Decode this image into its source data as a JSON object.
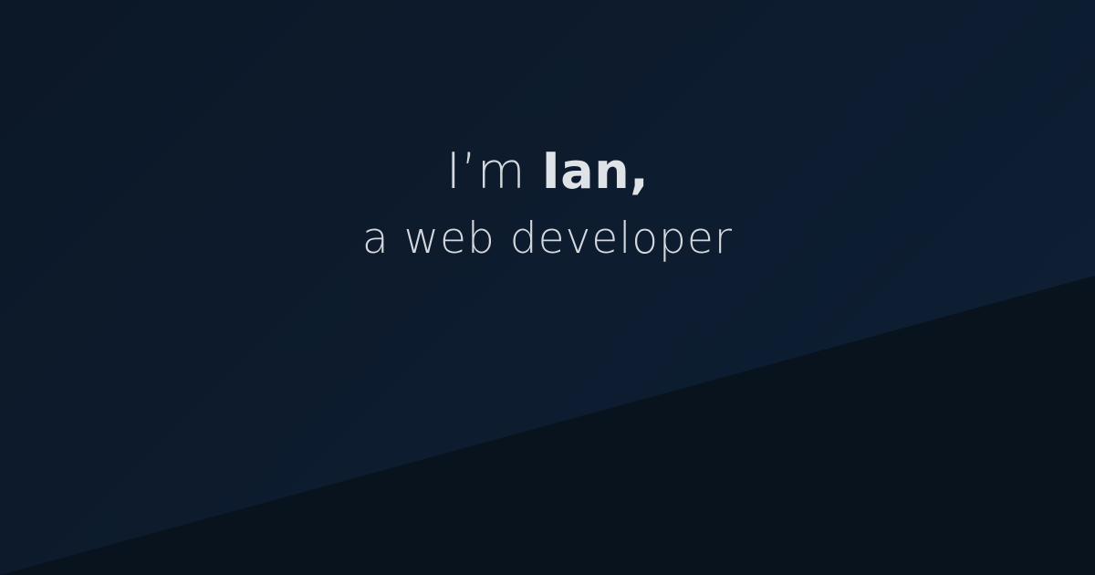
{
  "headline": {
    "prefix": "I’m ",
    "name": "Ian,",
    "tagline": "a web developer"
  },
  "colors": {
    "background": "#0d1a2b",
    "corner_shape": "#08131d",
    "text": "#d4d7dc"
  }
}
